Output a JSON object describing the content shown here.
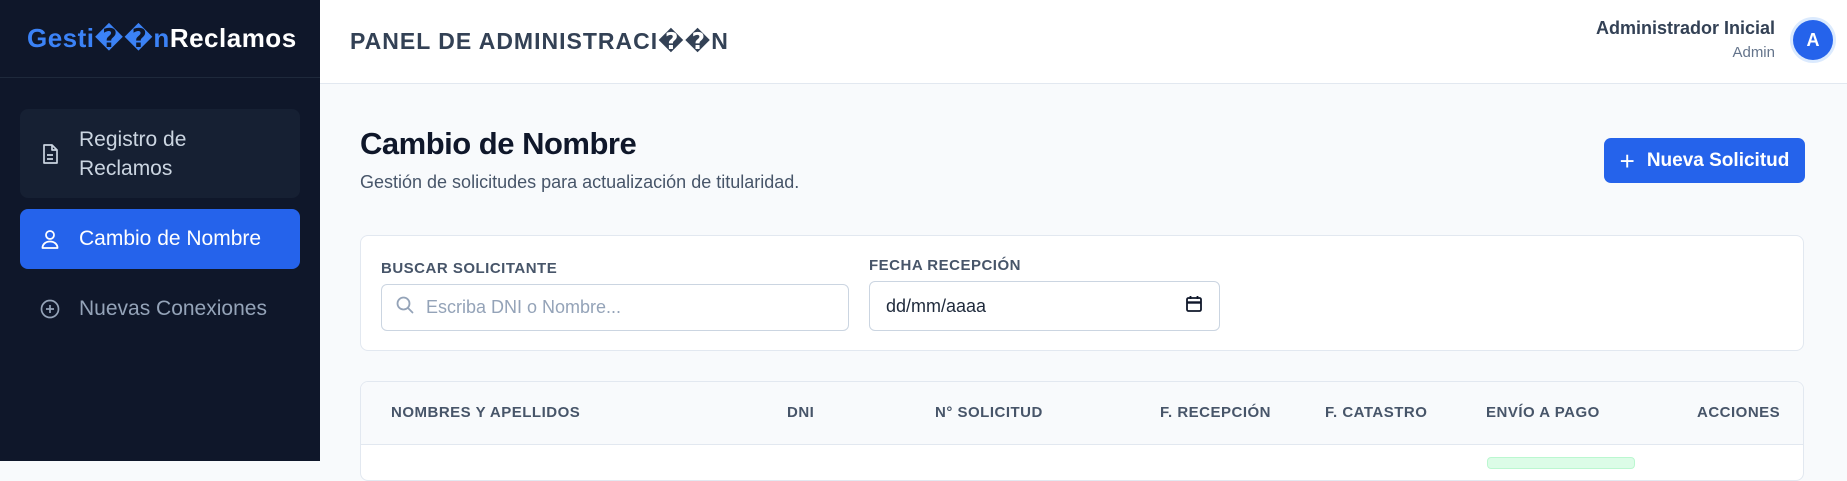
{
  "app": {
    "brand_part1": "Gesti��n",
    "brand_part2": "Reclamos"
  },
  "sidebar": {
    "items": [
      {
        "label": "Registro de Reclamos",
        "icon": "document-icon",
        "active": false
      },
      {
        "label": "Cambio de Nombre",
        "icon": "user-icon",
        "active": true
      },
      {
        "label": "Nuevas Conexiones",
        "icon": "plus-circle-icon",
        "active": false
      }
    ]
  },
  "header": {
    "title": "PANEL DE ADMINISTRACI��N",
    "user_name": "Administrador Inicial",
    "user_role": "Admin",
    "avatar_initial": "A"
  },
  "page": {
    "title": "Cambio de Nombre",
    "subtitle": "Gestión de solicitudes para actualización de titularidad.",
    "new_button_label": "Nueva Solicitud"
  },
  "filters": {
    "search_label": "BUSCAR SOLICITANTE",
    "search_placeholder": "Escriba DNI o Nombre...",
    "date_label": "FECHA RECEPCIÓN",
    "date_value": "dd/mm/aaaa"
  },
  "table": {
    "columns": [
      "NOMBRES Y APELLIDOS",
      "DNI",
      "N° SOLICITUD",
      "F. RECEPCIÓN",
      "F. CATASTRO",
      "ENVÍO A PAGO",
      "ACCIONES"
    ]
  },
  "colors": {
    "sidebar_bg": "#0f172a",
    "accent": "#2563eb",
    "brand_accent": "#3b82f6"
  }
}
